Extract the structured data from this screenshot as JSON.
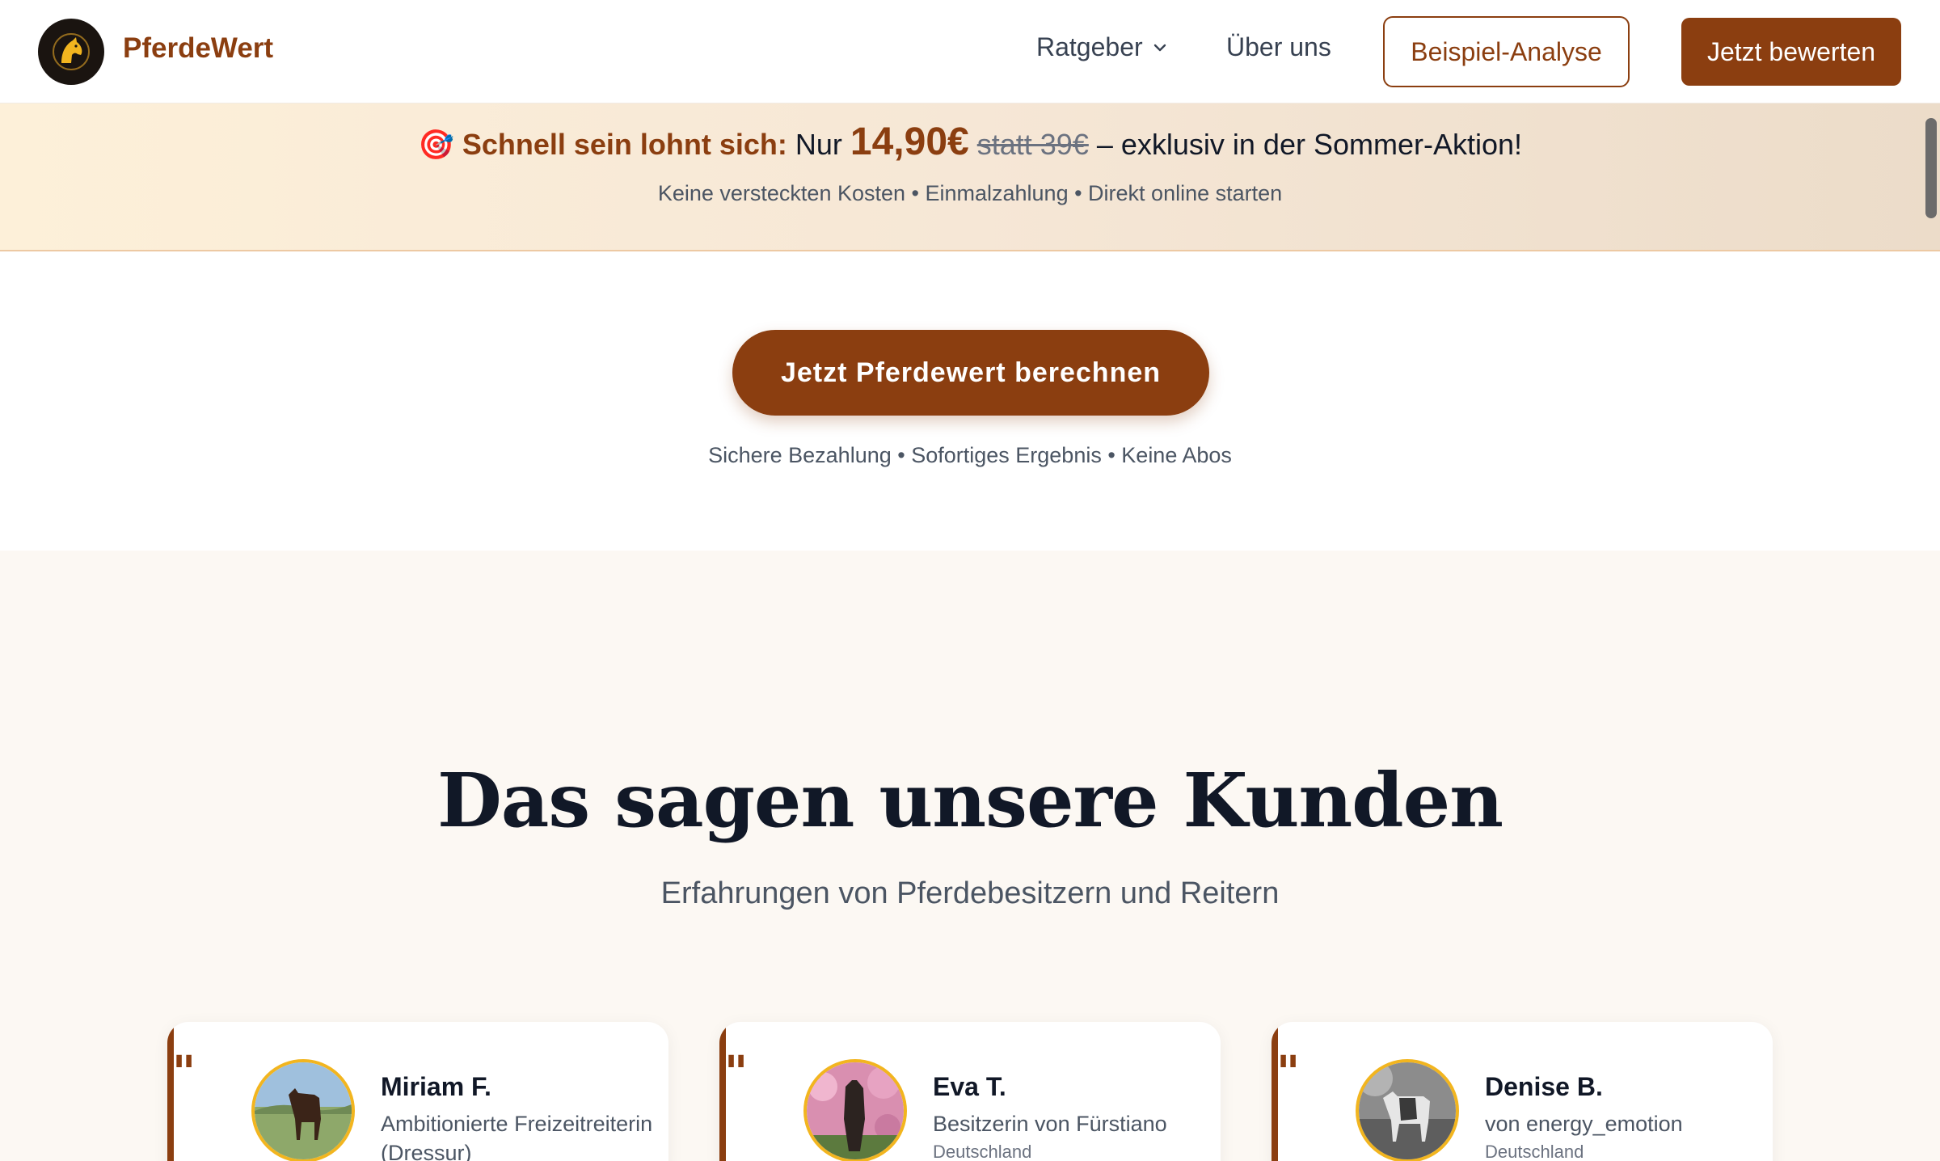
{
  "header": {
    "brand": "PferdeWert",
    "nav": {
      "ratgeber": "Ratgeber",
      "about": "Über uns"
    },
    "example_button": "Beispiel-Analyse",
    "cta_button": "Jetzt bewerten"
  },
  "promo": {
    "icon": "🎯",
    "lead": "Schnell sein lohnt sich:",
    "prefix": " Nur ",
    "price": "14,90€",
    "old_price": "statt 39€",
    "suffix": " – exklusiv in der Sommer-Aktion!",
    "subline": "Keine versteckten Kosten • Einmalzahlung • Direkt online starten"
  },
  "cta": {
    "button": "Jetzt Pferdewert berechnen",
    "note": "Sichere Bezahlung • Sofortiges Ergebnis • Keine Abos"
  },
  "testimonials": {
    "title": "Das sagen unsere Kunden",
    "subtitle": "Erfahrungen von Pferdebesitzern und Reitern",
    "items": [
      {
        "name": "Miriam F.",
        "role": "Ambitionierte Freizeitreiterin (Dressur)",
        "country": ""
      },
      {
        "name": "Eva T.",
        "role": "Besitzerin von Fürstiano",
        "country": "Deutschland"
      },
      {
        "name": "Denise B.",
        "role": "von energy_emotion",
        "country": "Deutschland"
      }
    ]
  },
  "colors": {
    "brand": "#8b3e10",
    "accent_gold": "#f2b51f",
    "promo_bg": "#fdf0d9",
    "section_bg": "#fcf8f3"
  },
  "icons": {
    "logo": "horse-head-icon",
    "dropdown": "chevron-down-icon",
    "promo": "target-icon",
    "quote": "quote-mark-icon"
  }
}
